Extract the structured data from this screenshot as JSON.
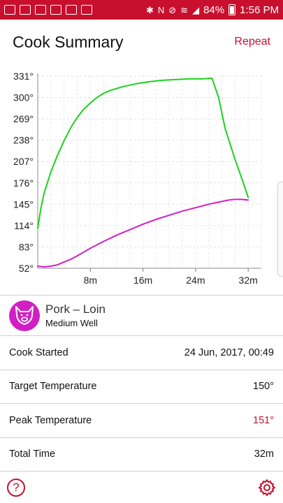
{
  "status_bar": {
    "battery": "84%",
    "time": "1:56 PM"
  },
  "header": {
    "title": "Cook Summary",
    "repeat_label": "Repeat"
  },
  "chart_data": {
    "type": "line",
    "y_ticks": [
      "331°",
      "300°",
      "269°",
      "238°",
      "207°",
      "176°",
      "145°",
      "114°",
      "83°",
      "52°"
    ],
    "x_ticks": [
      "8m",
      "16m",
      "24m",
      "32m"
    ],
    "ylim": [
      52,
      331
    ],
    "xlim": [
      0,
      34
    ],
    "grid": true,
    "series": [
      {
        "color": "#1bd21b",
        "points": [
          [
            0,
            110
          ],
          [
            0.5,
            140
          ],
          [
            1,
            162
          ],
          [
            2,
            192
          ],
          [
            3,
            216
          ],
          [
            4,
            237
          ],
          [
            5,
            256
          ],
          [
            6,
            271
          ],
          [
            7,
            283
          ],
          [
            8,
            292
          ],
          [
            9,
            300
          ],
          [
            10,
            306
          ],
          [
            11,
            310
          ],
          [
            12,
            313
          ],
          [
            13,
            316
          ],
          [
            15,
            320
          ],
          [
            17,
            323
          ],
          [
            19,
            325
          ],
          [
            21,
            326
          ],
          [
            23,
            327
          ],
          [
            25,
            327
          ],
          [
            26.5,
            328
          ],
          [
            27.5,
            300
          ],
          [
            28.5,
            255
          ],
          [
            30,
            210
          ],
          [
            31,
            183
          ],
          [
            32,
            155
          ]
        ]
      },
      {
        "color": "#d11fc4",
        "points": [
          [
            0,
            55
          ],
          [
            1,
            54
          ],
          [
            2,
            55
          ],
          [
            3,
            57
          ],
          [
            4,
            61
          ],
          [
            5,
            65
          ],
          [
            6,
            70
          ],
          [
            8,
            81
          ],
          [
            10,
            91
          ],
          [
            12,
            100
          ],
          [
            14,
            108
          ],
          [
            16,
            116
          ],
          [
            18,
            123
          ],
          [
            20,
            129
          ],
          [
            22,
            135
          ],
          [
            24,
            140
          ],
          [
            26,
            145
          ],
          [
            28,
            149
          ],
          [
            29,
            151
          ],
          [
            30,
            152
          ],
          [
            31,
            152
          ],
          [
            32,
            151
          ]
        ]
      }
    ]
  },
  "meat": {
    "name": "Pork – Loin",
    "doneness": "Medium Well"
  },
  "rows": [
    {
      "label": "Cook Started",
      "value": "24 Jun, 2017, 00:49"
    },
    {
      "label": "Target Temperature",
      "value": "150°"
    },
    {
      "label": "Peak Temperature",
      "value": "151°"
    },
    {
      "label": "Total Time",
      "value": "32m"
    }
  ],
  "bottom": {
    "help_icon": "question-circle-icon",
    "settings_icon": "gear-icon"
  }
}
